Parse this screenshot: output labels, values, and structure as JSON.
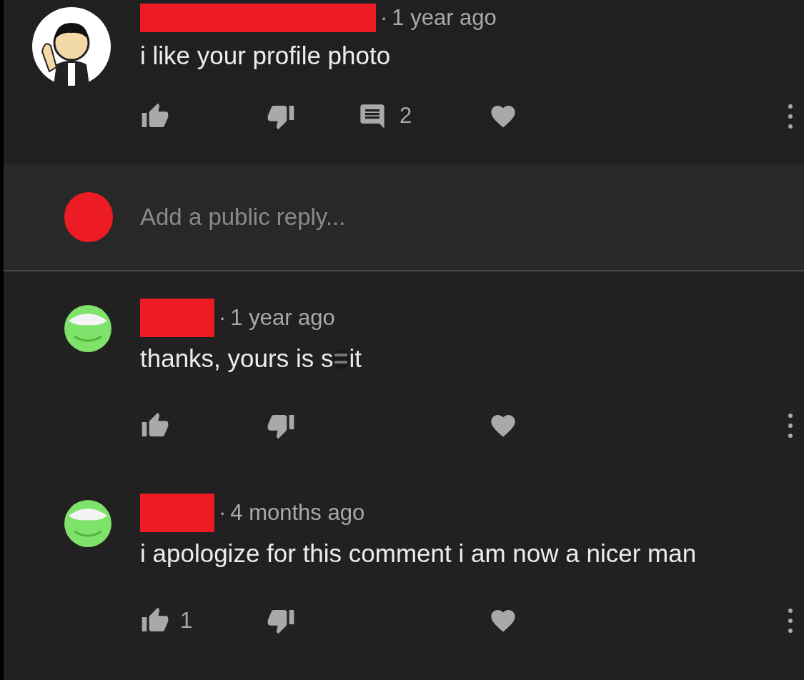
{
  "comment": {
    "avatar": {
      "kind": "figure"
    },
    "author_redacted": true,
    "separator": "·",
    "time": "1 year ago",
    "text": "i like your profile photo",
    "replies": "2"
  },
  "reply_box": {
    "avatar_redacted": true,
    "placeholder": "Add a public reply..."
  },
  "replies": [
    {
      "avatar": {
        "kind": "green"
      },
      "author_redacted": true,
      "separator": "·",
      "time": "1 year ago",
      "text": "thanks, yours is s",
      "text_after_sticker": "it"
    },
    {
      "avatar": {
        "kind": "green"
      },
      "author_redacted": true,
      "separator": "·",
      "time": "4 months ago",
      "text": "i apologize for this comment i am now a nicer man",
      "likes": "1"
    }
  ]
}
